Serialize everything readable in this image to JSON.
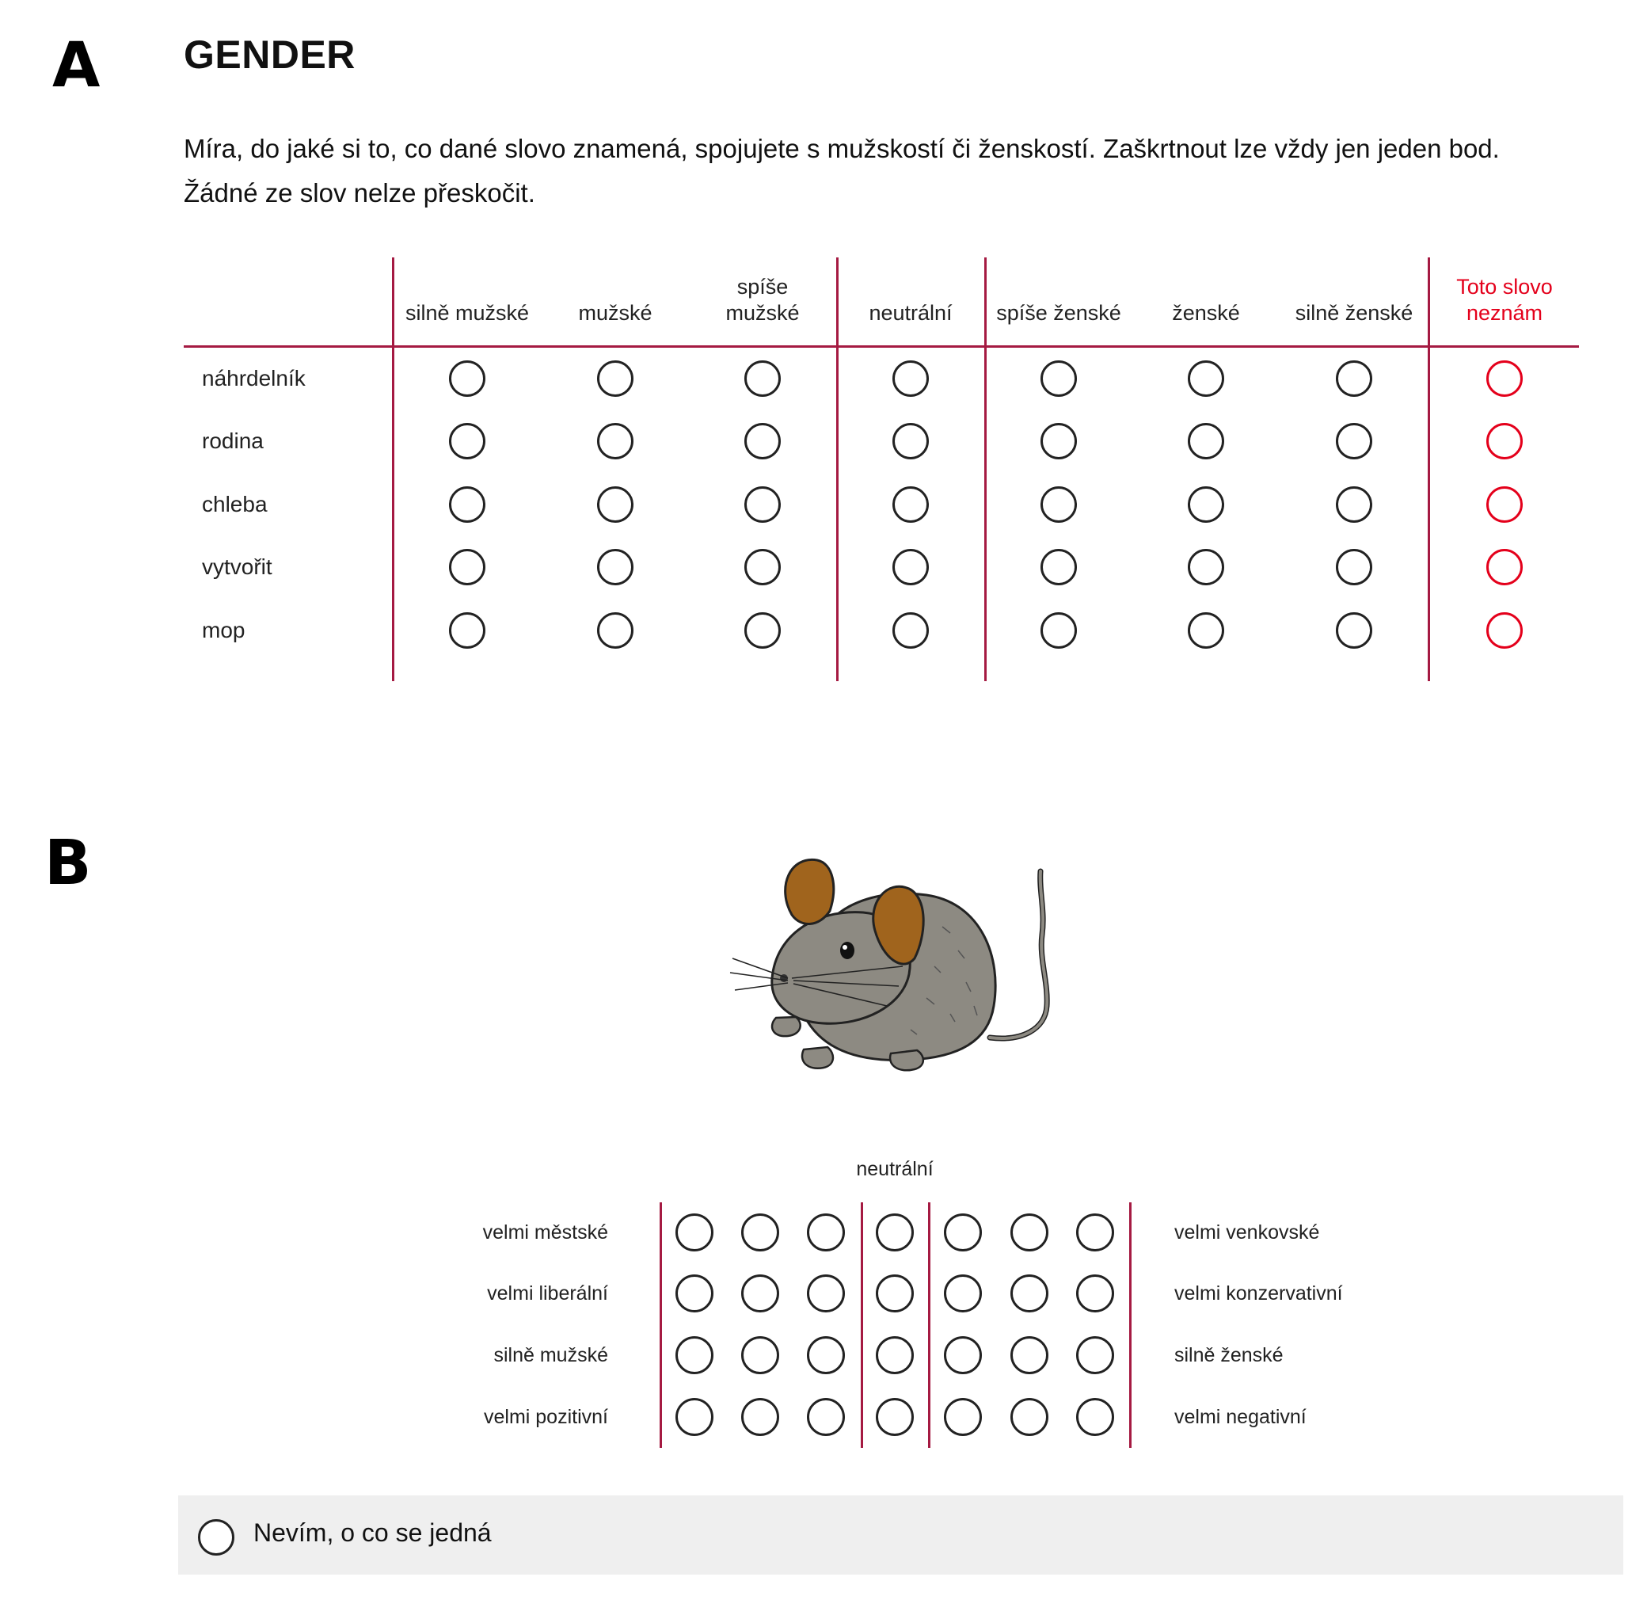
{
  "panel_a": {
    "letter": "A",
    "title": "GENDER",
    "instructions": "Míra, do jaké si to, co dané slovo znamená, spojujete s mužskostí či ženskostí. Zaškrtnout lze vždy jen jeden bod. Žádné ze slov nelze přeskočit.",
    "columns": [
      {
        "line1": "",
        "line2": "silně mužské"
      },
      {
        "line1": "",
        "line2": "mužské"
      },
      {
        "line1": "spíše",
        "line2": "mužské"
      },
      {
        "line1": "",
        "line2": "neutrální"
      },
      {
        "line1": "",
        "line2": "spíše ženské"
      },
      {
        "line1": "",
        "line2": "ženské"
      },
      {
        "line1": "",
        "line2": "silně ženské"
      },
      {
        "line1": "Toto slovo",
        "line2": "neznám"
      }
    ],
    "rows": [
      "náhrdelník",
      "rodina",
      "chleba",
      "vytvořit",
      "mop"
    ]
  },
  "panel_b": {
    "letter": "B",
    "image": "mouse-illustration",
    "neutral_label": "neutrální",
    "scales": [
      {
        "left": "velmi městské",
        "right": "velmi venkovské"
      },
      {
        "left": "velmi liberální",
        "right": "velmi konzervativní"
      },
      {
        "left": "silně mužské",
        "right": "silně ženské"
      },
      {
        "left": "velmi pozitivní",
        "right": "velmi negativní"
      }
    ],
    "dont_know": "Nevím, o co se jedná"
  },
  "colors": {
    "divider": "#a51a42",
    "unknown_option": "#e4001b",
    "dont_know_background": "#efefef"
  }
}
